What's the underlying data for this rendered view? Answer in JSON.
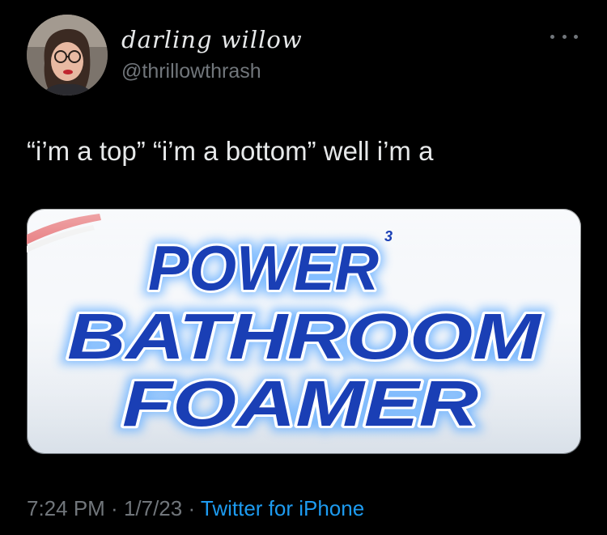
{
  "tweet": {
    "display_name": "darling willow",
    "handle": "@thrillowthrash",
    "text": "“i’m a top” “i’m a bottom” well i’m a",
    "time": "7:24 PM",
    "separator": " · ",
    "date": "1/7/23",
    "source": "Twitter for iPhone",
    "more_icon": "more-horizontal-icon"
  },
  "media": {
    "lines": [
      "POWER",
      "BATHROOM",
      "FOAMER"
    ],
    "superscript": "3",
    "text_color": "#1a3fb5",
    "accent_color": "#d8262c",
    "glow_color": "#6fb4ff"
  },
  "colors": {
    "background": "#000000",
    "primary_text": "#e7e9ea",
    "secondary_text": "#71767b",
    "link": "#1d9bf0"
  }
}
